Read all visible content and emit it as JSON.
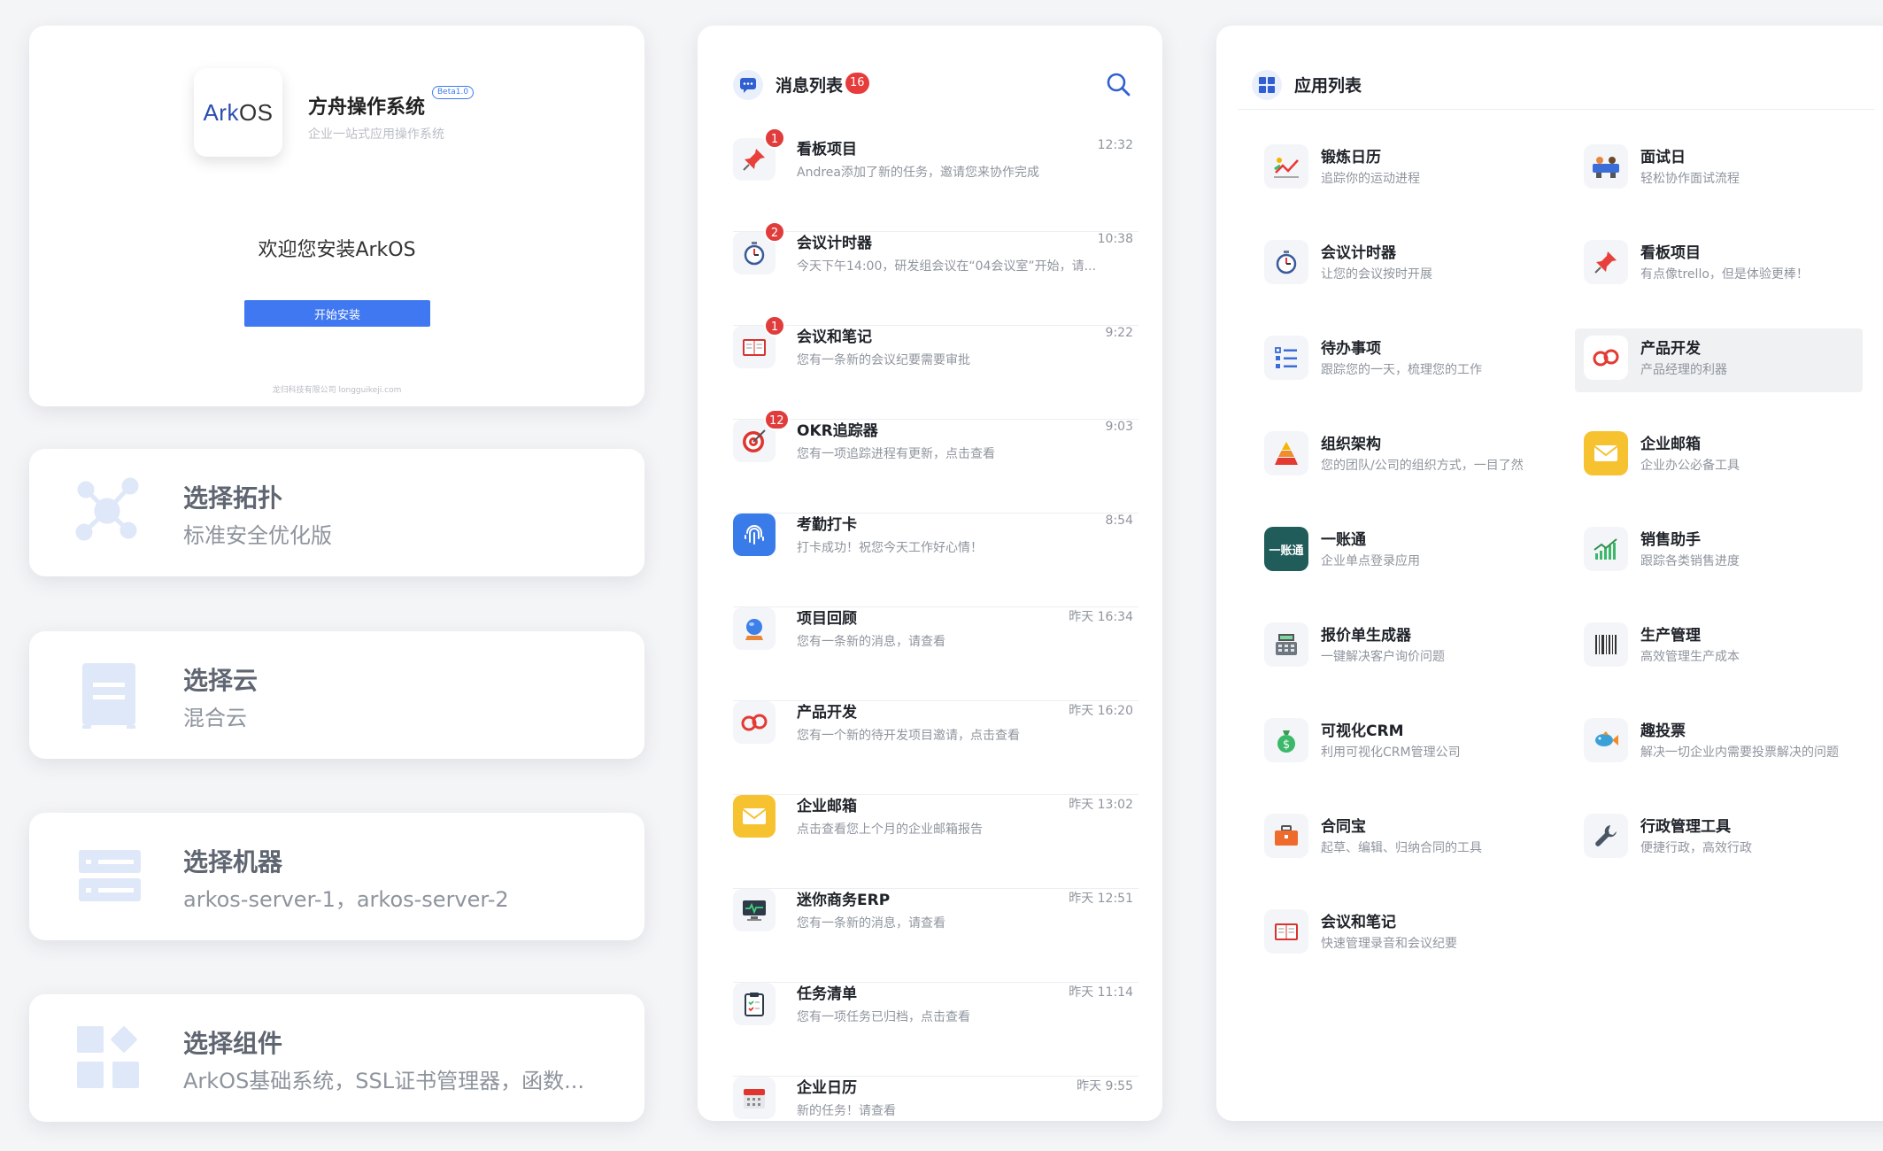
{
  "install": {
    "logo_ark": "Ark",
    "logo_os": "OS",
    "app_name": "方舟操作系统",
    "beta": "Beta1.0",
    "subtitle": "企业一站式应用操作系统",
    "welcome": "欢迎您安装ArkOS",
    "button": "开始安装",
    "copyright": "龙归科技有限公司 longguikeji.com"
  },
  "steps": [
    {
      "title": "选择拓扑",
      "desc": "标准安全优化版",
      "icon": "topology-icon"
    },
    {
      "title": "选择云",
      "desc": "混合云",
      "icon": "cloud-server-icon"
    },
    {
      "title": "选择机器",
      "desc": "arkos-server-1，arkos-server-2",
      "icon": "machine-icon"
    },
    {
      "title": "选择组件",
      "desc": "ArkOS基础系统，SSL证书管理器，函数...",
      "icon": "components-icon"
    }
  ],
  "messages": {
    "title": "消息列表",
    "count": "16",
    "items": [
      {
        "title": "看板项目",
        "time": "12:32",
        "desc": "Andrea添加了新的任务，邀请您来协作完成",
        "badge": "1",
        "icon": "pin-icon"
      },
      {
        "title": "会议计时器",
        "time": "10:38",
        "desc": "今天下午14:00，研发组会议在“04会议室”开始，请...",
        "badge": "2",
        "icon": "stopwatch-icon"
      },
      {
        "title": "会议和笔记",
        "time": "9:22",
        "desc": "您有一条新的会议纪要需要审批",
        "badge": "1",
        "icon": "notebook-icon"
      },
      {
        "title": "OKR追踪器",
        "time": "9:03",
        "desc": "您有一项追踪进程有更新，点击查看",
        "badge": "12",
        "icon": "target-icon"
      },
      {
        "title": "考勤打卡",
        "time": "8:54",
        "desc": "打卡成功！祝您今天工作好心情！",
        "badge": "",
        "icon": "fingerprint-icon"
      },
      {
        "title": "项目回顾",
        "time": "昨天  16:34",
        "desc": "您有一条新的消息，请查看",
        "badge": "",
        "icon": "crystal-ball-icon"
      },
      {
        "title": "产品开发",
        "time": "昨天  16:20",
        "desc": "您有一个新的待开发项目邀请，点击查看",
        "badge": "",
        "icon": "infinity-icon"
      },
      {
        "title": "企业邮箱",
        "time": "昨天  13:02",
        "desc": "点击查看您上个月的企业邮箱报告",
        "badge": "",
        "icon": "mail-icon"
      },
      {
        "title": "迷你商务ERP",
        "time": "昨天  12:51",
        "desc": "您有一条新的消息，请查看",
        "badge": "",
        "icon": "monitor-icon"
      },
      {
        "title": "任务清单",
        "time": "昨天  11:14",
        "desc": "您有一项任务已归档，点击查看",
        "badge": "",
        "icon": "clipboard-icon"
      },
      {
        "title": "企业日历",
        "time": "昨天  9:55",
        "desc": "新的任务！请查看",
        "badge": "",
        "icon": "calendar-icon"
      }
    ]
  },
  "apps": {
    "title": "应用列表",
    "items": [
      {
        "title": "锻炼日历",
        "desc": "追踪你的运动进程",
        "icon": "fitness-chart-icon"
      },
      {
        "title": "面试日",
        "desc": "轻松协作面试流程",
        "icon": "interview-icon"
      },
      {
        "title": "会议计时器",
        "desc": "让您的会议按时开展",
        "icon": "stopwatch-icon"
      },
      {
        "title": "看板项目",
        "desc": "有点像trello，但是体验更棒！",
        "icon": "pin-icon"
      },
      {
        "title": "待办事项",
        "desc": "跟踪您的一天，梳理您的工作",
        "icon": "todo-list-icon"
      },
      {
        "title": "产品开发",
        "desc": "产品经理的利器",
        "icon": "infinity-icon"
      },
      {
        "title": "组织架构",
        "desc": "您的团队/公司的组织方式，一目了然",
        "icon": "pyramid-icon"
      },
      {
        "title": "企业邮箱",
        "desc": "企业办公必备工具",
        "icon": "mail-icon"
      },
      {
        "title": "一账通",
        "desc": "企业单点登录应用",
        "icon": "sso-icon",
        "icon_text": "一账通"
      },
      {
        "title": "销售助手",
        "desc": "跟踪各类销售进度",
        "icon": "sales-chart-icon"
      },
      {
        "title": "报价单生成器",
        "desc": "一键解决客户询价问题",
        "icon": "cash-register-icon"
      },
      {
        "title": "生产管理",
        "desc": "高效管理生产成本",
        "icon": "barcode-icon"
      },
      {
        "title": "可视化CRM",
        "desc": "利用可视化CRM管理公司",
        "icon": "money-bag-icon"
      },
      {
        "title": "趣投票",
        "desc": "解决一切企业内需要投票解决的问题",
        "icon": "fish-icon"
      },
      {
        "title": "合同宝",
        "desc": "起草、编辑、归纳合同的工具",
        "icon": "briefcase-icon"
      },
      {
        "title": "行政管理工具",
        "desc": "便捷行政，高效行政",
        "icon": "wrench-icon"
      },
      {
        "title": "会议和笔记",
        "desc": "快速管理录音和会议纪要",
        "icon": "notebook-icon"
      }
    ]
  },
  "colors": {
    "accent": "#3f78f0",
    "badge": "#e03c3c",
    "step_icon": "#dfe8f8"
  }
}
